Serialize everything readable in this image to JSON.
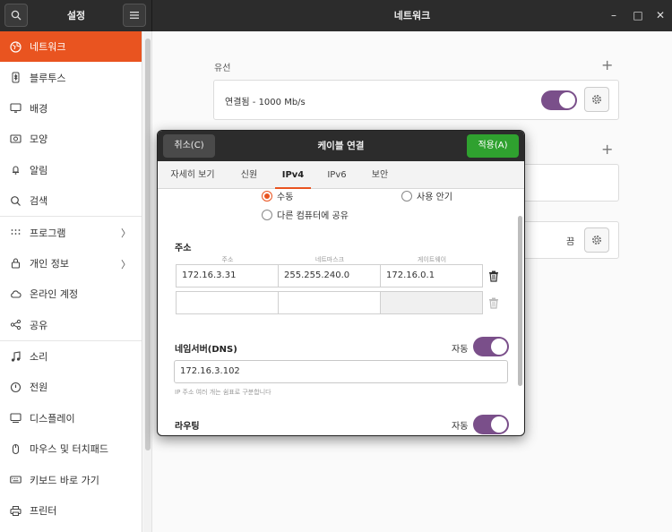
{
  "header": {
    "left_title": "설정",
    "main_title": "네트워크"
  },
  "sidebar": {
    "items": [
      {
        "label": "네트워크",
        "icon": "network-icon"
      },
      {
        "label": "블루투스",
        "icon": "bluetooth-icon"
      },
      {
        "label": "배경",
        "icon": "monitor-icon"
      },
      {
        "label": "모양",
        "icon": "appearance-icon"
      },
      {
        "label": "알림",
        "icon": "bell-icon"
      },
      {
        "label": "검색",
        "icon": "search-icon"
      },
      {
        "label": "프로그램",
        "icon": "apps-grid-icon"
      },
      {
        "label": "개인 정보",
        "icon": "lock-icon"
      },
      {
        "label": "온라인 계정",
        "icon": "cloud-icon"
      },
      {
        "label": "공유",
        "icon": "share-icon"
      },
      {
        "label": "소리",
        "icon": "music-note-icon"
      },
      {
        "label": "전원",
        "icon": "power-icon"
      },
      {
        "label": "디스플레이",
        "icon": "display-icon"
      },
      {
        "label": "마우스 및 터치패드",
        "icon": "mouse-icon"
      },
      {
        "label": "키보드 바로 가기",
        "icon": "keyboard-icon"
      },
      {
        "label": "프린터",
        "icon": "printer-icon"
      }
    ]
  },
  "main": {
    "wired_title": "유선",
    "wired_status": "연결됨 - 1000 Mb/s",
    "row3_status": "끔"
  },
  "dialog": {
    "cancel_label": "취소(C)",
    "title": "케이블 연결",
    "apply_label": "적용(A)",
    "tabs": [
      "자세히 보기",
      "신원",
      "IPv4",
      "IPv6",
      "보안"
    ],
    "active_tab": "IPv4",
    "method_options": [
      "수동",
      "사용 안기",
      "다른 컴퓨터에 공유"
    ],
    "address_title": "주소",
    "col_headers": [
      "주소",
      "네트마스크",
      "게이트웨이"
    ],
    "address_rows": [
      {
        "address": "172.16.3.31",
        "netmask": "255.255.240.0",
        "gateway": "172.16.0.1"
      },
      {
        "address": "",
        "netmask": "",
        "gateway": ""
      }
    ],
    "dns_title": "네임서버(DNS)",
    "dns_auto_label": "자동",
    "dns_value": "172.16.3.102",
    "dns_hint": "IP 주소 여러 개는 쉼표로 구분합니다",
    "routing_title": "라우팅",
    "routing_auto_label": "자동"
  },
  "colors": {
    "accent": "#e95420",
    "apply": "#2fa12f",
    "toggle": "#7a4f8a"
  }
}
